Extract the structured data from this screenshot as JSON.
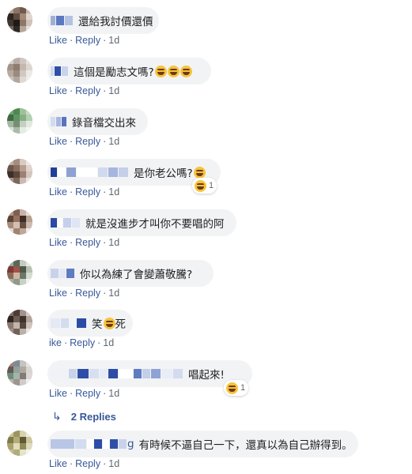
{
  "actions": {
    "like": "Like",
    "reply": "Reply",
    "separator": "·",
    "time": "1d",
    "like_short": "ike"
  },
  "comments": [
    {
      "text": "還給我討價還價"
    },
    {
      "text": "這個是勵志文嗎?"
    },
    {
      "text": "錄音檔交出來"
    },
    {
      "text": "是你老公嗎?",
      "reaction_count": "1"
    },
    {
      "text": "就是沒進步才叫你不要唱的阿"
    },
    {
      "text": "你以為練了會變蕭敬騰?"
    },
    {
      "text_a": "笑",
      "text_b": "死"
    },
    {
      "text": "唱起來!",
      "reaction_count": "1",
      "replies_label": "2 Replies"
    },
    {
      "name_tail": "g",
      "text": "有時候不逼自己一下，還真以為自己辦得到。"
    }
  ],
  "colors": {
    "link": "#385898",
    "meta": "#606770",
    "bubble": "#f2f3f5",
    "emoji": "#f7c33b"
  }
}
